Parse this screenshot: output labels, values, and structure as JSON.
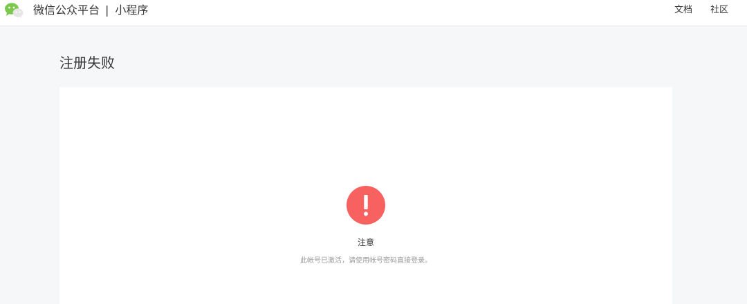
{
  "header": {
    "brand": "微信公众平台",
    "separator": "|",
    "product": "小程序",
    "nav": {
      "docs": "文档",
      "community": "社区"
    }
  },
  "main": {
    "title": "注册失败",
    "notice": {
      "icon": "warning-icon",
      "icon_color": "#f76260",
      "title": "注意",
      "description": "此帐号已激活，请使用帐号密码直接登录。"
    }
  },
  "colors": {
    "wechat_green": "#7bc84c",
    "page_background": "#f6f7f9"
  }
}
